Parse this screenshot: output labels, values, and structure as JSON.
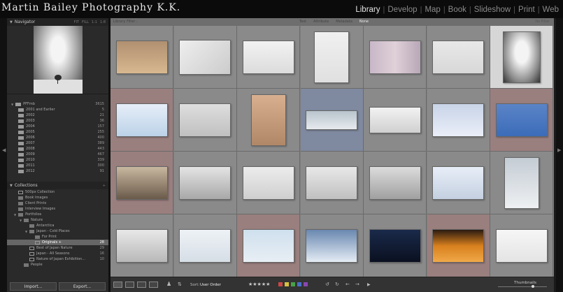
{
  "app": {
    "brand": "Martin Bailey Photography K.K.",
    "modules": [
      "Library",
      "Develop",
      "Map",
      "Book",
      "Slideshow",
      "Print",
      "Web"
    ],
    "active_module": "Library"
  },
  "navigator": {
    "title": "Navigator",
    "zoom_options": [
      "FIT",
      "FILL",
      "1:1",
      "1:8"
    ]
  },
  "folders": [
    {
      "label": "PFFmb",
      "count": "3615",
      "tri": "▼",
      "indent": 0
    },
    {
      "label": "2001 and Earlier",
      "count": "5",
      "indent": 1
    },
    {
      "label": "2002",
      "count": "21",
      "indent": 1
    },
    {
      "label": "2003",
      "count": "36",
      "indent": 1
    },
    {
      "label": "2004",
      "count": "157",
      "indent": 1
    },
    {
      "label": "2005",
      "count": "255",
      "indent": 1
    },
    {
      "label": "2006",
      "count": "400",
      "indent": 1
    },
    {
      "label": "2007",
      "count": "389",
      "indent": 1
    },
    {
      "label": "2008",
      "count": "443",
      "indent": 1
    },
    {
      "label": "2009",
      "count": "467",
      "indent": 1
    },
    {
      "label": "2010",
      "count": "339",
      "indent": 1
    },
    {
      "label": "2011",
      "count": "300",
      "indent": 1
    },
    {
      "label": "2012",
      "count": "91",
      "indent": 1
    }
  ],
  "collections": {
    "title": "Collections",
    "items": [
      {
        "label": "500px Collection",
        "indent": 1,
        "type": "coll"
      },
      {
        "label": "Book Images",
        "indent": 1,
        "type": "set"
      },
      {
        "label": "Client Prints",
        "indent": 1,
        "type": "set"
      },
      {
        "label": "Interview Images",
        "indent": 1,
        "type": "set"
      },
      {
        "label": "Portfolios",
        "indent": 1,
        "type": "set",
        "tri": "▼"
      },
      {
        "label": "Nature",
        "indent": 2,
        "type": "set",
        "tri": "▼"
      },
      {
        "label": "Antarctica",
        "indent": 3,
        "type": "set"
      },
      {
        "label": "Japan - Cold Places",
        "indent": 3,
        "type": "set",
        "tri": "▼"
      },
      {
        "label": "For Print",
        "indent": 4,
        "type": "set"
      },
      {
        "label": "Originals +",
        "indent": 4,
        "type": "coll",
        "count": "28",
        "selected": true
      },
      {
        "label": "Best of Japan Nature",
        "indent": 3,
        "type": "coll",
        "count": "29"
      },
      {
        "label": "Japan - All Seasons",
        "indent": 3,
        "type": "coll",
        "count": "16"
      },
      {
        "label": "Nature of Japan Exhibition...",
        "indent": 3,
        "type": "coll",
        "count": "10"
      },
      {
        "label": "People",
        "indent": 2,
        "type": "set"
      }
    ]
  },
  "buttons": {
    "import": "Import...",
    "export": "Export..."
  },
  "filter_bar": {
    "library_filter": "Library Filter :",
    "filters": [
      "Text",
      "Attribute",
      "Metadata",
      "None"
    ],
    "active_filter": "None",
    "custom": "No Filter"
  },
  "toolbar": {
    "sort_label": "Sort:",
    "sort_value": "User Order",
    "stars": "★★★★★",
    "thumbnails_label": "Thumbnails",
    "label_colors": [
      "#c84848",
      "#d8c040",
      "#48a048",
      "#4870c8",
      "#8848b0"
    ],
    "thumbnail_size_fraction": 0.72
  },
  "grid": {
    "cells": [
      {
        "state": "normal"
      },
      {
        "state": "normal"
      },
      {
        "state": "normal"
      },
      {
        "state": "normal"
      },
      {
        "state": "normal"
      },
      {
        "state": "normal"
      },
      {
        "state": "current"
      },
      {
        "state": "rejected"
      },
      {
        "state": "normal"
      },
      {
        "state": "normal"
      },
      {
        "state": "selected"
      },
      {
        "state": "normal"
      },
      {
        "state": "normal"
      },
      {
        "state": "rejected"
      },
      {
        "state": "rejected"
      },
      {
        "state": "normal"
      },
      {
        "state": "normal"
      },
      {
        "state": "normal"
      },
      {
        "state": "normal"
      },
      {
        "state": "normal"
      },
      {
        "state": "normal"
      },
      {
        "state": "normal"
      },
      {
        "state": "normal"
      },
      {
        "state": "rejected"
      },
      {
        "state": "normal"
      },
      {
        "state": "normal"
      },
      {
        "state": "rejected"
      },
      {
        "state": "normal"
      }
    ]
  }
}
